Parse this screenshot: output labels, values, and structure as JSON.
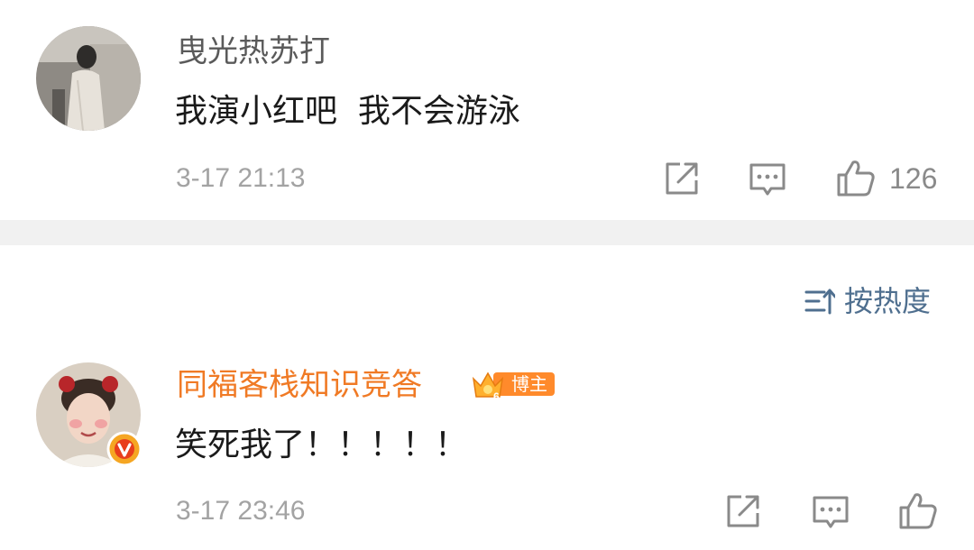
{
  "comments": [
    {
      "username": "曳光热苏打",
      "text": "我演小红吧  我不会游泳",
      "timestamp": "3-17 21:13",
      "like_count": "126",
      "username_color": "#5a5a5a"
    },
    {
      "username": "同福客栈知识竞答",
      "badge_label": "博主",
      "text": "笑死我了！！！！！",
      "timestamp": "3-17 23:46",
      "username_color": "#f07a25"
    }
  ],
  "sort": {
    "label": "按热度"
  },
  "colors": {
    "icon": "#8a8a8a",
    "sort_accent": "#4f6f8f",
    "verified_badge": "#f5a623",
    "blogger_badge": "#ff8a2b",
    "divider": "#f1f1f1"
  },
  "icons": {
    "share": "share-icon",
    "reply": "comment-icon",
    "like": "thumbs-up-icon",
    "sort": "sort-icon",
    "verified": "verified-v-icon",
    "level": "level-crown-icon"
  }
}
